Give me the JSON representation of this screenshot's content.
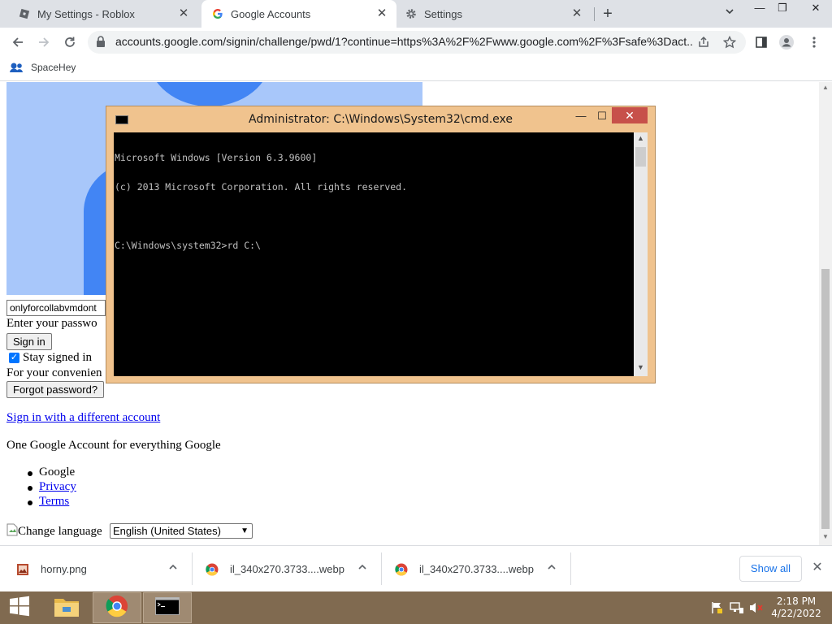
{
  "browser": {
    "tabs": [
      {
        "label": "My Settings - Roblox",
        "icon": "roblox-icon",
        "active": false
      },
      {
        "label": "Google Accounts",
        "icon": "google-icon",
        "active": true
      },
      {
        "label": "Settings",
        "icon": "gear-icon",
        "active": false
      }
    ],
    "url": "accounts.google.com/signin/challenge/pwd/1?continue=https%3A%2F%2Fwww.google.com%2F%3Fsafe%3Dact...",
    "bookmarks": [
      {
        "label": "SpaceHey",
        "icon": "spacehey-icon"
      }
    ]
  },
  "page": {
    "email_value": "onlyforcollabvmdont",
    "enter_password_text": "Enter your passwo",
    "sign_in_label": "Sign in",
    "stay_signed_in_label": "Stay signed in",
    "stay_signed_in_checked": true,
    "convenience_text": "For your convenien",
    "forgot_password_label": "Forgot password?",
    "different_account_link": "Sign in with a different account",
    "tagline": "One Google Account for everything Google",
    "footer_items": [
      "Google",
      "Privacy",
      "Terms"
    ],
    "change_language_alt": "Change language",
    "language_selected": "English (United States)"
  },
  "cmd": {
    "title": "Administrator: C:\\Windows\\System32\\cmd.exe",
    "lines": [
      "Microsoft Windows [Version 6.3.9600]",
      "(c) 2013 Microsoft Corporation. All rights reserved.",
      "",
      "C:\\Windows\\system32>rd C:\\"
    ]
  },
  "downloads": {
    "items": [
      {
        "name": "horny.png",
        "icon": "image-file-icon"
      },
      {
        "name": "il_340x270.3733....webp",
        "icon": "chrome-icon"
      },
      {
        "name": "il_340x270.3733....webp",
        "icon": "chrome-icon"
      }
    ],
    "show_all_label": "Show all"
  },
  "taskbar": {
    "time": "2:18 PM",
    "date": "4/22/2022"
  },
  "colors": {
    "taskbar": "#806a50",
    "cmd_frame": "#f0c38e",
    "cmd_close": "#c7504a",
    "avatar_bg": "#a8c7fa",
    "avatar_fg": "#4285f4"
  }
}
